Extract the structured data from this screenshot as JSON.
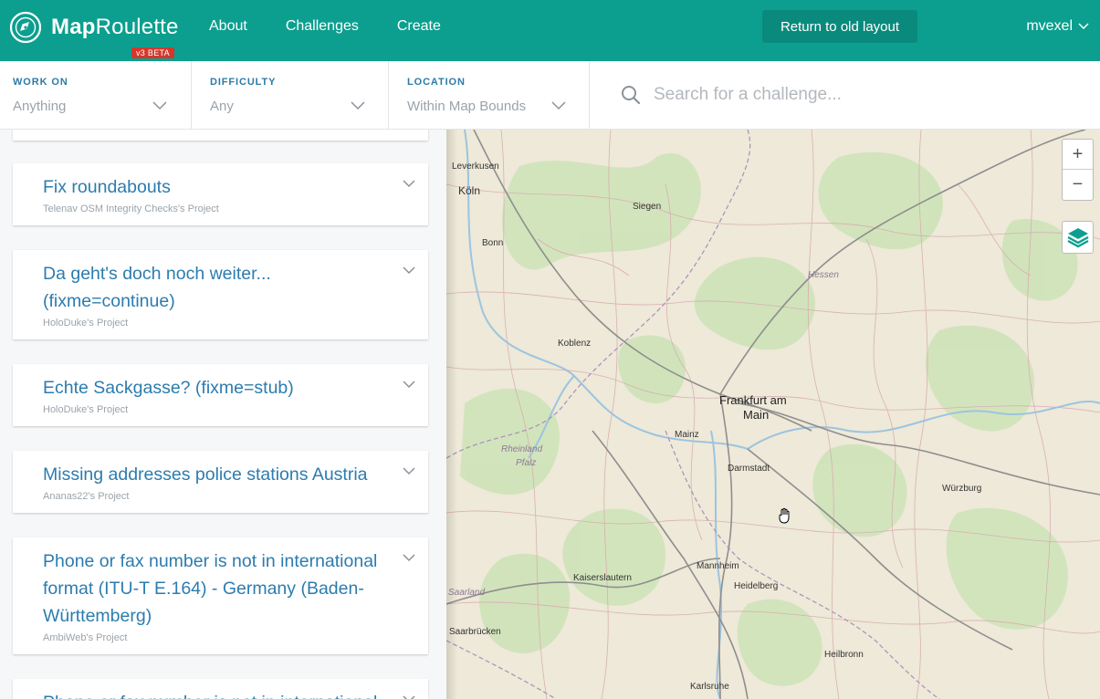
{
  "header": {
    "brand_bold": "Map",
    "brand_rest": "Roulette",
    "badge": "v3 BETA",
    "nav": [
      "About",
      "Challenges",
      "Create"
    ],
    "old_layout_label": "Return to old layout",
    "username": "mvexel",
    "bg_color": "#0c9f8f"
  },
  "filters": {
    "work_on": {
      "label": "WORK ON",
      "value": "Anything"
    },
    "difficulty": {
      "label": "DIFFICULTY",
      "value": "Any"
    },
    "location": {
      "label": "LOCATION",
      "value": "Within Map Bounds"
    },
    "search_placeholder": "Search for a challenge..."
  },
  "challenges": [
    {
      "title": "Fix roundabouts",
      "owner": "Telenav OSM Integrity Checks's Project"
    },
    {
      "title": "Da geht's doch noch weiter... (fixme=continue)",
      "owner": "HoloDuke's Project"
    },
    {
      "title": "Echte Sackgasse? (fixme=stub)",
      "owner": "HoloDuke's Project"
    },
    {
      "title": "Missing addresses police stations Austria",
      "owner": "Ananas22's Project"
    },
    {
      "title": "Phone or fax number is not in international format (ITU-T E.164) - Germany (Baden-Württemberg)",
      "owner": "AmbiWeb's Project"
    },
    {
      "title": "Phone or fax number is not in international",
      "owner": ""
    }
  ],
  "map": {
    "cities": [
      "Leverkusen",
      "Köln",
      "Siegen",
      "Bonn",
      "Koblenz",
      "Frankfurt am",
      "Main",
      "Mainz",
      "Darmstadt",
      "Würzburg",
      "Kaiserslautern",
      "Mannheim",
      "Heidelberg",
      "Saarbrücken",
      "Heilbronn",
      "Karlsruhe"
    ],
    "regions": [
      "Hessen",
      "Rheinland",
      "Pfalz",
      "Saarland"
    ],
    "zoom_in": "+",
    "zoom_out": "−"
  }
}
